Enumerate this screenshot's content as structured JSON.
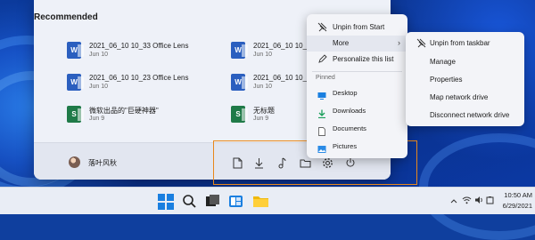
{
  "start_menu": {
    "recommended_title": "Recommended",
    "items": [
      {
        "name": "2021_06_10 10_33 Office Lens",
        "date": "Jun 10",
        "icon": "word-file-icon",
        "glyph": "W"
      },
      {
        "name": "2021_06_10 10_32 Office Lens",
        "date": "Jun 10",
        "icon": "word-file-icon",
        "glyph": "W"
      },
      {
        "name": "2021_06_10 10_23 Office Lens",
        "date": "Jun 10",
        "icon": "word-file-icon",
        "glyph": "W"
      },
      {
        "name": "2021_06_10 10_31 Office Lens",
        "date": "Jun 10",
        "icon": "word-file-icon",
        "glyph": "W"
      },
      {
        "name": "微软出品的\"巨硬神器\"",
        "date": "Jun 9",
        "icon": "sheet-file-icon",
        "glyph": "S"
      },
      {
        "name": "无标题",
        "date": "Jun 9",
        "icon": "sheet-file-icon",
        "glyph": "S"
      }
    ],
    "user_name": "落叶风秋",
    "footer_icons": [
      "document-icon",
      "download-icon",
      "music-icon",
      "folder-icon",
      "settings-icon",
      "power-icon"
    ]
  },
  "context_menu": {
    "unpin_start": "Unpin from Start",
    "more": "More",
    "personalize": "Personalize this list",
    "pinned_label": "Pinned",
    "pinned": [
      {
        "label": "Desktop",
        "icon": "desktop-icon",
        "color": "#1a7fe0"
      },
      {
        "label": "Downloads",
        "icon": "download-icon",
        "color": "#1a9e5a"
      },
      {
        "label": "Documents",
        "icon": "document-icon",
        "color": "#666666"
      },
      {
        "label": "Pictures",
        "icon": "pictures-icon",
        "color": "#2b8be6"
      }
    ]
  },
  "submenu": {
    "unpin_taskbar": "Unpin from taskbar",
    "manage": "Manage",
    "properties": "Properties",
    "map_drive": "Map network drive",
    "disconnect_drive": "Disconnect network drive"
  },
  "taskbar": {
    "time": "10:50 AM",
    "date": "6/29/2021",
    "accent": "#1a7fe0"
  }
}
